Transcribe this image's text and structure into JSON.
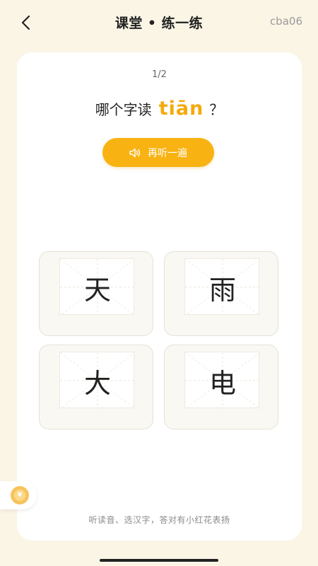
{
  "header": {
    "title": "课堂 • 练一练",
    "tag": "cba06",
    "back_icon": "chevron-left-icon"
  },
  "quiz": {
    "progress": "1/2",
    "question_prefix": "哪个字读",
    "pinyin": "tiān",
    "question_suffix": "？",
    "replay_label": "再听一遍",
    "replay_icon": "speaker-icon",
    "options": [
      "天",
      "雨",
      "大",
      "电"
    ],
    "hint": "听读音、选汉字，答对有小红花表扬"
  },
  "float_button": {
    "icon": "coin-icon"
  },
  "colors": {
    "background": "#fbf5e6",
    "accent": "#f8b313",
    "pinyin": "#f4aa0b"
  }
}
